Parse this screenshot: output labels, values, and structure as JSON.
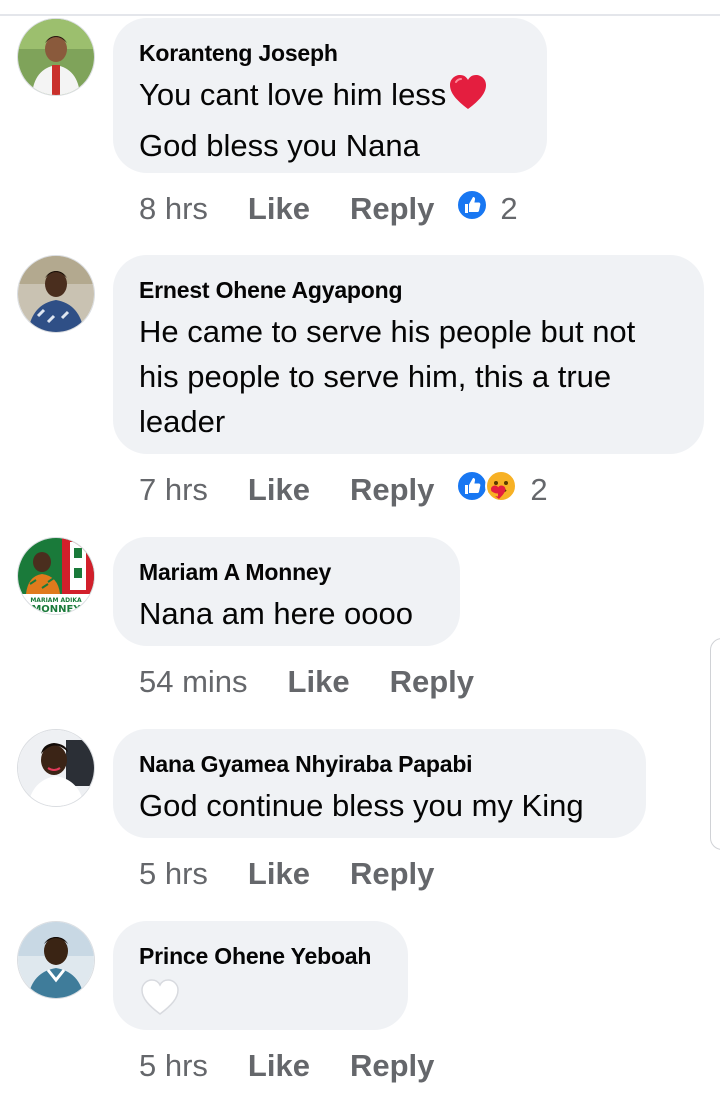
{
  "comments": [
    {
      "author": "Koranteng Joseph",
      "lines": [
        "You cant love him less",
        "God bless you Nana"
      ],
      "time": "8 hrs",
      "like": "Like",
      "reply": "Reply",
      "reaction_count": "2",
      "reactions": [
        "like-icon"
      ]
    },
    {
      "author": "Ernest Ohene Agyapong",
      "lines": [
        "He came to serve his people but not",
        "his people to serve him, this a true",
        "leader"
      ],
      "time": "7 hrs",
      "like": "Like",
      "reply": "Reply",
      "reaction_count": "2",
      "reactions": [
        "like-icon",
        "care-icon"
      ]
    },
    {
      "author": "Mariam A Monney",
      "lines": [
        "Nana am here oooo"
      ],
      "time": "54 mins",
      "like": "Like",
      "reply": "Reply",
      "avatar_text": [
        "MARIAM ADIKA",
        "MONNEY"
      ]
    },
    {
      "author": "Nana Gyamea Nhyiraba Papabi",
      "lines": [
        "God continue bless you my King"
      ],
      "time": "5 hrs",
      "like": "Like",
      "reply": "Reply"
    },
    {
      "author": "Prince Ohene Yeboah",
      "lines": [],
      "emoji": "white-heart-icon",
      "time": "5 hrs",
      "like": "Like",
      "reply": "Reply"
    }
  ],
  "colors": {
    "bubble": "#f0f2f5",
    "meta_text": "#65676b",
    "like_blue": "#1877f2",
    "heart_red": "#e41e3f"
  }
}
